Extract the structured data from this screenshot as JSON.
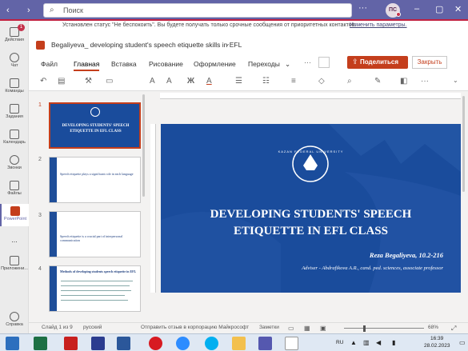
{
  "teams": {
    "search_placeholder": "Поиск",
    "avatar_initials": "ПС",
    "rail": [
      {
        "label": "Действия",
        "badge": "1"
      },
      {
        "label": "Чат"
      },
      {
        "label": "Команды"
      },
      {
        "label": "Задания"
      },
      {
        "label": "Календарь"
      },
      {
        "label": "Звонки"
      },
      {
        "label": "Файлы"
      },
      {
        "label": "PowerPoint"
      },
      {
        "label": "..."
      },
      {
        "label": "Приложени..."
      },
      {
        "label": "Справка"
      }
    ]
  },
  "notice": {
    "text": "Установлен статус \"Не беспокоить\". Вы будете получать только срочные сообщения от приоритетных контактов.",
    "link": "Изменить параметры."
  },
  "document": {
    "title": "Begaliyeva_ developing student's speech etiquette skills in EFL",
    "share_label": "Поделиться",
    "close_label": "Закрыть"
  },
  "ribbon_tabs": [
    "Файл",
    "Главная",
    "Вставка",
    "Рисование",
    "Оформление",
    "Переходы"
  ],
  "active_tab": "Главная",
  "thumbnails": [
    {
      "num": "1",
      "title": "DEVELOPING STUDENTS' SPEECH ETIQUETTE IN EFL CLASS"
    },
    {
      "num": "2",
      "title": "Speech etiquette plays a significant role in each language"
    },
    {
      "num": "3",
      "title": "Speech etiquette is a crucial part of interpersonal communication"
    },
    {
      "num": "4",
      "title": "Methods of developing students speech etiquette in EFL"
    }
  ],
  "slide": {
    "university": "KAZAN FEDERAL UNIVERSITY",
    "title_line1": "DEVELOPING STUDENTS' SPEECH",
    "title_line2": "ETIQUETTE IN EFL CLASS",
    "author": "Reza Begaliyeva, 10.2-216",
    "advisor": "Adviser - Abdrafikova A.R., cand. ped. sciences, associate professor"
  },
  "status": {
    "slide_info": "Слайд 1 из 9",
    "language": "русский",
    "feedback": "Отправить отзыв в корпорацию Майкрософт",
    "notes": "Заметки",
    "zoom": "68%"
  },
  "tray": {
    "lang": "RU",
    "time": "16:39",
    "date": "28.02.2023"
  },
  "colors": {
    "brand": "#6264a7",
    "slide_bg": "#1a4c9c",
    "share": "#c43e1c"
  }
}
